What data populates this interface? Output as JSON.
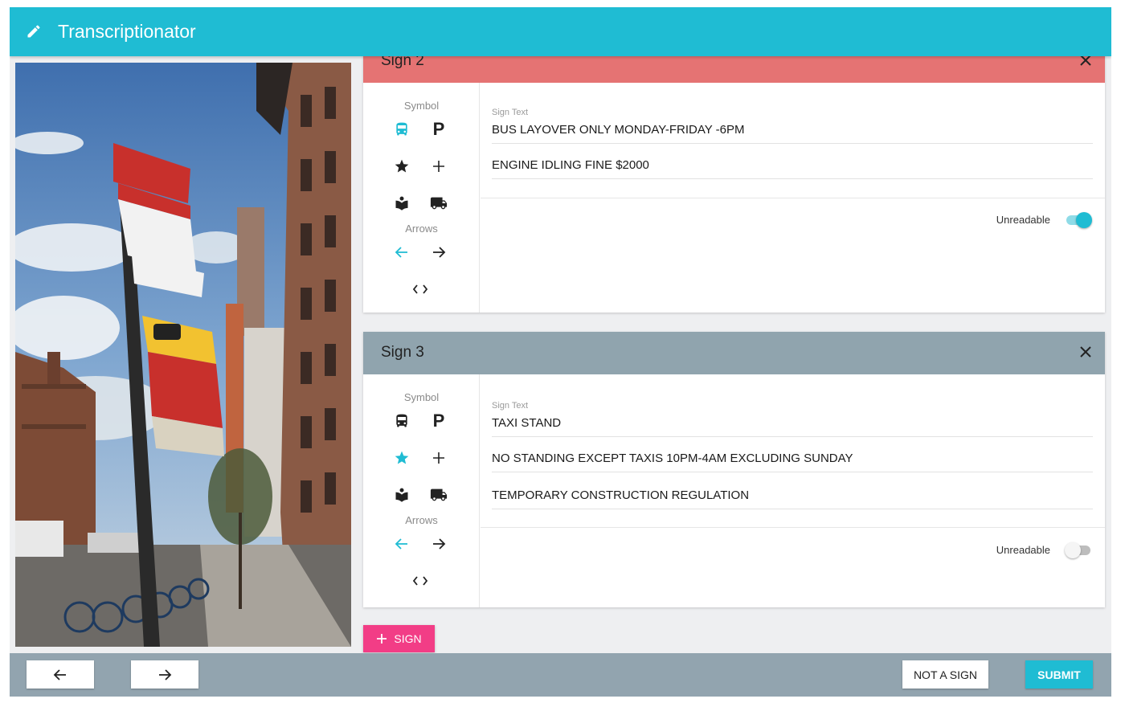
{
  "header": {
    "title": "Transcriptionator",
    "icon": "pencil-icon",
    "bg_color": "#1fbcd3"
  },
  "photo": {
    "alt_kind": "street-sign-photo"
  },
  "signs": [
    {
      "title": "Sign 2",
      "header_color": "#e57373",
      "symbol_label": "Symbol",
      "arrows_label": "Arrows",
      "selected_symbol": "bus",
      "selected_arrow": "left",
      "sign_text_label": "Sign Text",
      "lines": [
        "BUS LAYOVER ONLY MONDAY-FRIDAY -6PM",
        "ENGINE IDLING FINE $2000"
      ],
      "unreadable_label": "Unreadable",
      "unreadable": true
    },
    {
      "title": "Sign 3",
      "header_color": "#90a4ae",
      "symbol_label": "Symbol",
      "arrows_label": "Arrows",
      "selected_symbol": "star",
      "selected_arrow": "left",
      "sign_text_label": "Sign Text",
      "lines": [
        "TAXI STAND",
        "NO STANDING EXCEPT TAXIS 10PM-4AM EXCLUDING SUNDAY",
        "TEMPORARY CONSTRUCTION REGULATION"
      ],
      "unreadable_label": "Unreadable",
      "unreadable": false
    }
  ],
  "add_sign": {
    "label": "SIGN",
    "color": "#f23d86"
  },
  "footer": {
    "not_a_sign_label": "NOT A SIGN",
    "submit_label": "SUBMIT",
    "bg_color": "#92a4af",
    "accent": "#1fbcd3"
  }
}
